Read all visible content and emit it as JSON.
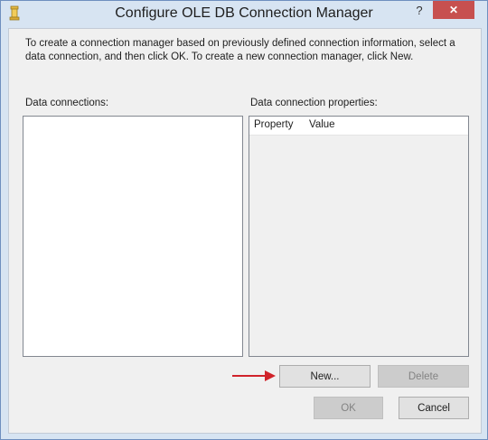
{
  "window": {
    "title": "Configure OLE DB Connection Manager",
    "help_glyph": "?",
    "close_glyph": "✕"
  },
  "instructions": "To create a connection manager based on previously defined connection information, select a data connection, and then click OK. To create a new connection manager, click New.",
  "data_connections": {
    "label": "Data connections:",
    "items": []
  },
  "properties": {
    "label": "Data connection properties:",
    "columns": [
      "Property",
      "Value"
    ],
    "rows": []
  },
  "buttons": {
    "new": "New...",
    "delete": "Delete",
    "ok": "OK",
    "cancel": "Cancel"
  },
  "colors": {
    "annotation_arrow": "#d0232a",
    "close_button": "#c7504f"
  }
}
